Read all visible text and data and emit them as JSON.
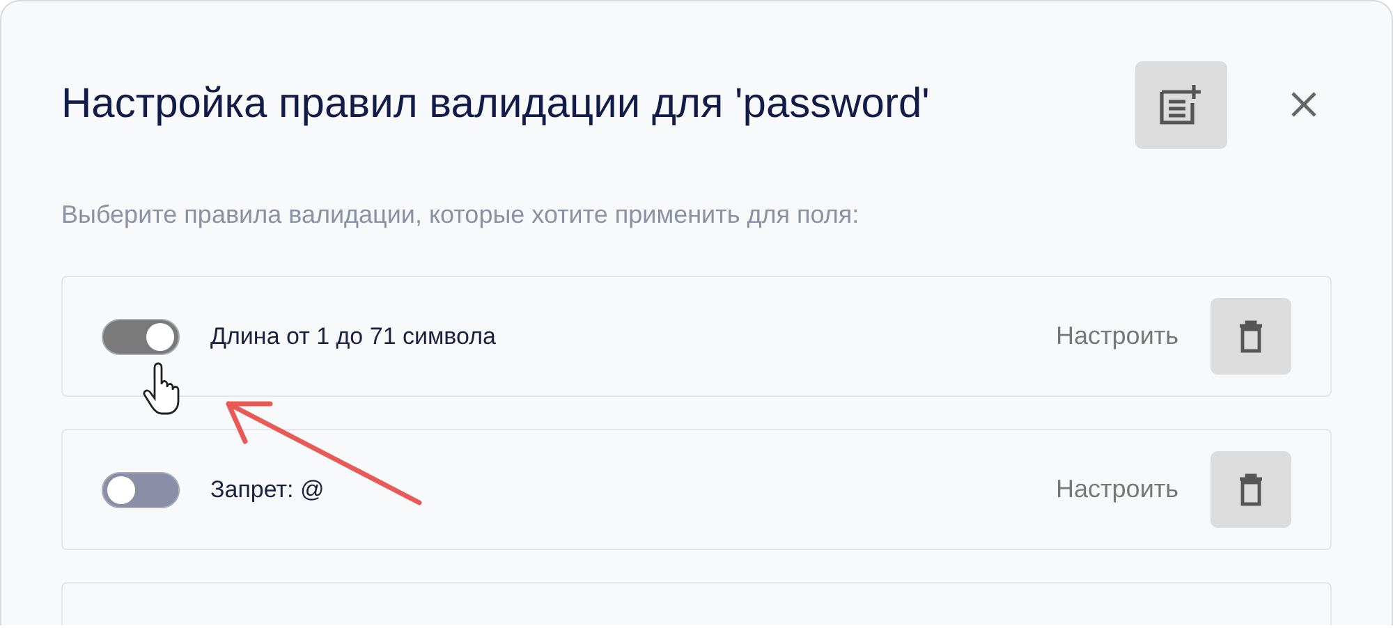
{
  "dialog": {
    "title": "Настройка правил валидации для 'password'",
    "subtitle": "Выберите правила валидации, которые хотите применить для поля:"
  },
  "rules": [
    {
      "label": "Длина от 1 до 71 символа",
      "on": true,
      "configure": "Настроить"
    },
    {
      "label": "Запрет: @",
      "on": false,
      "configure": "Настроить"
    }
  ]
}
